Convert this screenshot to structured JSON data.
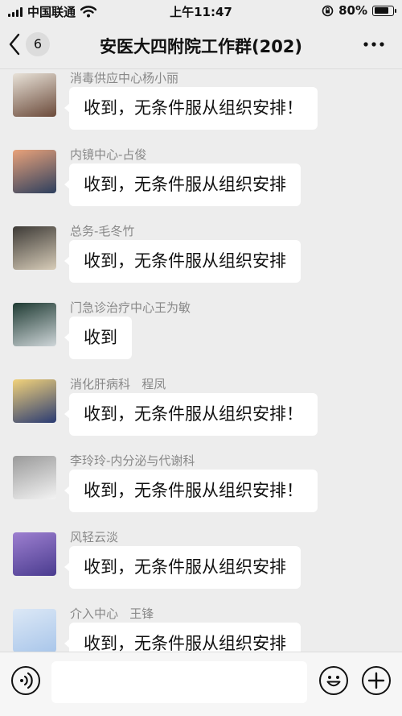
{
  "status_bar": {
    "carrier": "中国联通",
    "time": "上午11:47",
    "battery_percent": "80%",
    "battery_level": 0.8,
    "icons": [
      "signal-icon",
      "wifi-icon",
      "orientation-lock-icon",
      "battery-icon"
    ]
  },
  "nav": {
    "back_icon": "chevron-left-icon",
    "unread_count": "6",
    "title": "安医大四附院工作群(202)",
    "more_icon": "more-dots-icon"
  },
  "messages": [
    {
      "sender": "消毒供应中心杨小丽",
      "text": "收到，无条件服从组织安排！",
      "avatar": "avatar-person-photo",
      "avatar_colors": [
        "#6b4a3a",
        "#e8e2d8"
      ]
    },
    {
      "sender": "内镜中心-占俊",
      "text": "收到，无条件服从组织安排",
      "avatar": "avatar-cartoon-pig",
      "avatar_colors": [
        "#2d3f5e",
        "#e9a27a"
      ]
    },
    {
      "sender": "总务-毛冬竹",
      "text": "收到，无条件服从组织安排",
      "avatar": "avatar-pug-dog",
      "avatar_colors": [
        "#d8cdb9",
        "#3d3a36"
      ]
    },
    {
      "sender": "门急诊治疗中心王为敏",
      "text": "收到",
      "avatar": "avatar-toy-car",
      "avatar_colors": [
        "#cfd6d9",
        "#1f3b33"
      ]
    },
    {
      "sender": "消化肝病科   程凤",
      "text": "收到，无条件服从组织安排！",
      "avatar": "avatar-balloons-sky",
      "avatar_colors": [
        "#2a3b73",
        "#f2d27a"
      ]
    },
    {
      "sender": "李玲玲-内分泌与代谢科",
      "text": "收到，无条件服从组织安排！",
      "avatar": "avatar-sketch-girl",
      "avatar_colors": [
        "#f3f3f3",
        "#9a9a9a"
      ]
    },
    {
      "sender": "风轻云淡",
      "text": "收到，无条件服从组织安排",
      "avatar": "avatar-lavender-field",
      "avatar_colors": [
        "#4a3c8f",
        "#9d7fd0"
      ]
    },
    {
      "sender": "介入中心   王锋",
      "text": "收到，无条件服从组织安排",
      "avatar": "avatar-blue-sky",
      "avatar_colors": [
        "#a9c6ea",
        "#dce8f6"
      ]
    }
  ],
  "input_bar": {
    "voice_icon": "voice-icon",
    "input_value": "",
    "emoji_icon": "emoji-icon",
    "plus_icon": "plus-icon"
  }
}
